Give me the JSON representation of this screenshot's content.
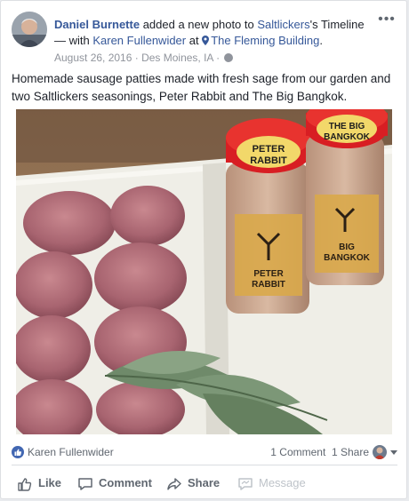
{
  "post": {
    "author": "Daniel Burnette",
    "action_text": " added a new photo to ",
    "target": "Saltlickers",
    "target_suffix": "'s Timeline",
    "with_prefix": "— with ",
    "with_person": "Karen Fullenwider",
    "at_text": " at ",
    "place": "The Fleming Building",
    "place_suffix": ".",
    "date": "August 26, 2016",
    "location_meta": " · Des Moines, IA · ",
    "caption": "Homemade sausage patties made with fresh sage from our garden and two Saltlickers seasonings, Peter Rabbit and The Big Bangkok.",
    "more_label": "•••"
  },
  "photo": {
    "jar_left_label_line1": "PETER",
    "jar_left_label_line2": "RABBIT",
    "jar_right_label_line1": "THE BIG",
    "jar_right_label_line2": "BANGKOK",
    "jar_left_side_label_line1": "PETER",
    "jar_left_side_label_line2": "RABBIT",
    "jar_right_side_label_line1": "BIG",
    "jar_right_side_label_line2": "BANGKOK"
  },
  "stats": {
    "liker": "Karen Fullenwider",
    "comments": "1 Comment",
    "shares": "1 Share"
  },
  "actions": {
    "like": "Like",
    "comment": "Comment",
    "share": "Share",
    "message": "Message"
  },
  "colors": {
    "link": "#365899",
    "brand_blue": "#4267b2",
    "muted": "#606770"
  }
}
